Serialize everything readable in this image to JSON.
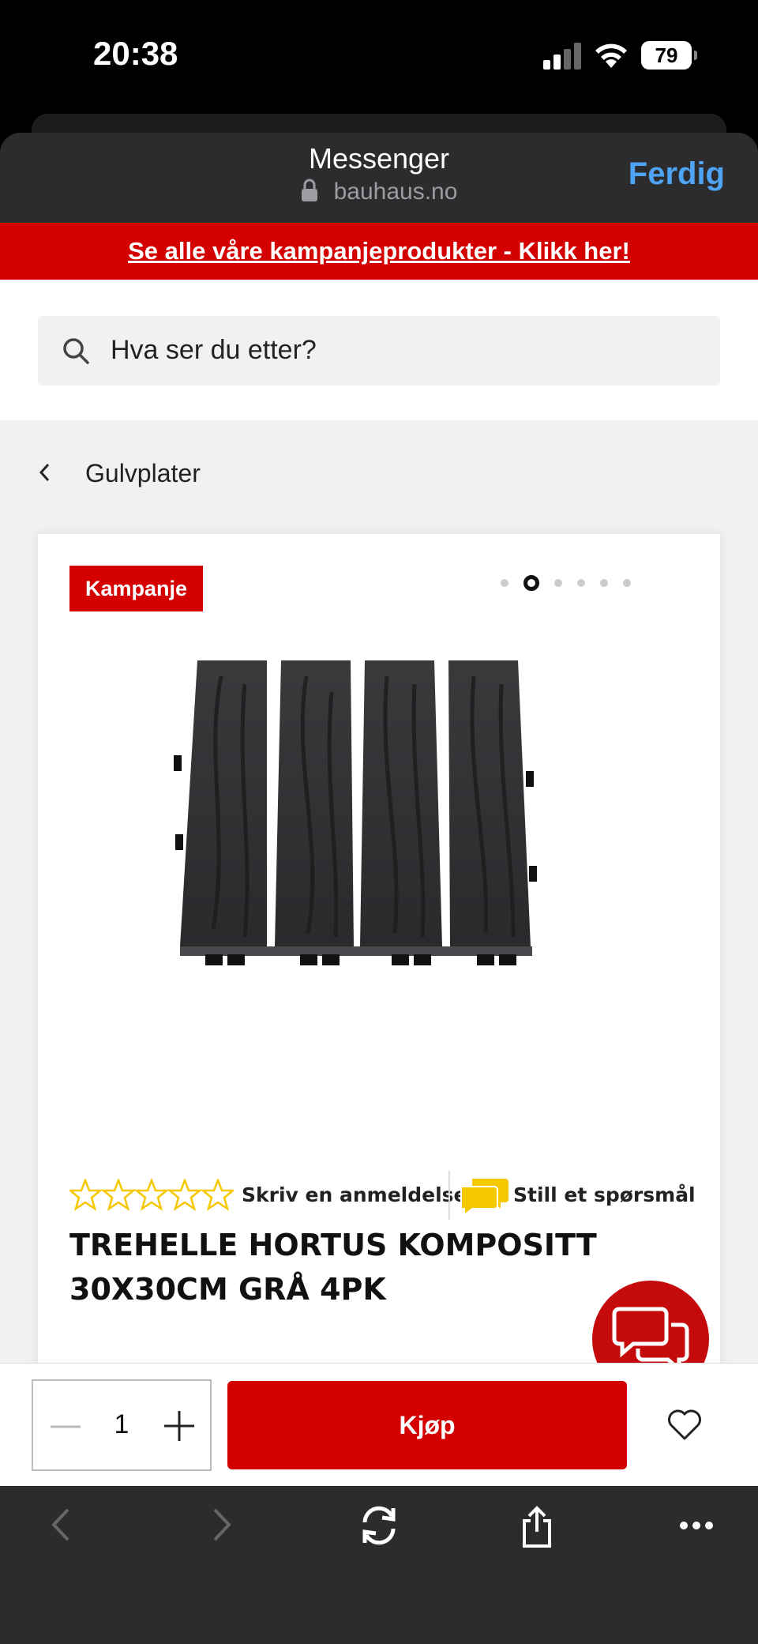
{
  "status_bar": {
    "time": "20:38",
    "battery": "79"
  },
  "browser": {
    "title": "Messenger",
    "url": "bauhaus.no",
    "done_label": "Ferdig"
  },
  "promo_banner": {
    "text": "Se alle våre kampanjeprodukter - Klikk her!"
  },
  "search": {
    "placeholder": "Hva ser du etter?"
  },
  "breadcrumb": {
    "label": "Gulvplater"
  },
  "product": {
    "badge": "Kampanje",
    "image_count": 6,
    "active_image_index": 1,
    "rating": 0,
    "rating_max": 5,
    "review_link": "Skriv en anmeldelse",
    "question_link": "Still et spørsmål",
    "title": "TREHELLE HORTUS KOMPOSITT 30X30CM GRÅ 4PK"
  },
  "buy_bar": {
    "quantity": "1",
    "buy_label": "Kjøp"
  },
  "colors": {
    "brand_red": "#d40000",
    "link_blue": "#4ea3f5",
    "star_yellow": "#f5c800"
  }
}
